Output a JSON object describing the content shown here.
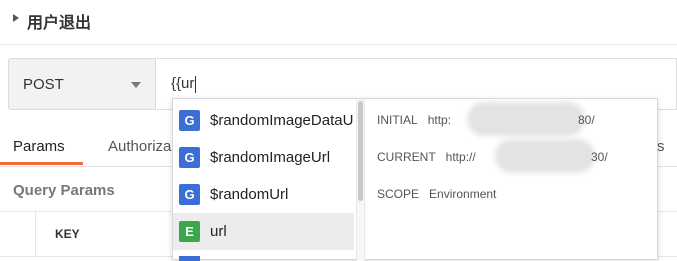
{
  "header": {
    "title": "用户退出"
  },
  "request": {
    "method": "POST",
    "url_value": "{{ur"
  },
  "tabs": [
    {
      "label": "Params"
    },
    {
      "label": "Authoriza"
    },
    {
      "label": "s"
    }
  ],
  "query_params": {
    "title": "Query Params",
    "column_key": "KEY"
  },
  "autocomplete": {
    "suggestions": [
      {
        "badge": "G",
        "label": "$randomImageDataU",
        "badge_color": "#3b6fd6"
      },
      {
        "badge": "G",
        "label": "$randomImageUrl",
        "badge_color": "#3b6fd6"
      },
      {
        "badge": "G",
        "label": "$randomUrl",
        "badge_color": "#3b6fd6"
      },
      {
        "badge": "E",
        "label": "url",
        "badge_color": "#3aa84a"
      }
    ],
    "details": {
      "initial_label": "INITIAL",
      "initial_value_prefix": "http:",
      "initial_value_suffix": "80/",
      "current_label": "CURRENT",
      "current_value_prefix": "http://",
      "current_value_suffix": "30/",
      "scope_label": "SCOPE",
      "scope_value": "Environment"
    }
  },
  "colors": {
    "accent": "#f26b3a"
  }
}
